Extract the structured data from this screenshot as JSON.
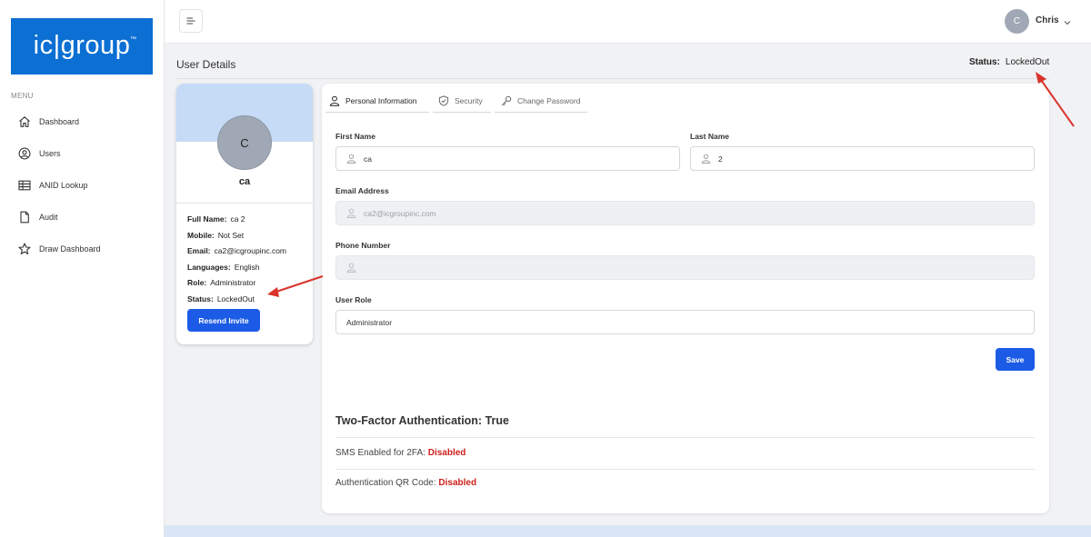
{
  "brand": {
    "logo_text": "ic|group",
    "logo_tm": "™"
  },
  "sidebar": {
    "menu_caption": "MENU",
    "items": [
      {
        "label": "Dashboard",
        "icon": "home-icon"
      },
      {
        "label": "Users",
        "icon": "user-circle-icon"
      },
      {
        "label": "ANID Lookup",
        "icon": "table-icon"
      },
      {
        "label": "Audit",
        "icon": "document-icon"
      },
      {
        "label": "Draw Dashboard",
        "icon": "star-icon"
      }
    ]
  },
  "topbar": {
    "user_initial": "C",
    "user_name": "Chris"
  },
  "page": {
    "title": "User Details",
    "status_label": "Status:",
    "status_value": "LockedOut"
  },
  "profile": {
    "initial": "C",
    "name": "ca",
    "details": [
      {
        "key": "Full Name:",
        "value": "ca 2"
      },
      {
        "key": "Mobile:",
        "value": "Not Set"
      },
      {
        "key": "Email:",
        "value": "ca2@icgroupinc.com"
      },
      {
        "key": "Languages:",
        "value": "English"
      },
      {
        "key": "Role:",
        "value": "Administrator"
      },
      {
        "key": "Status:",
        "value": "LockedOut"
      }
    ],
    "resend_label": "Resend Invite"
  },
  "tabs": [
    {
      "label": "Personal Information",
      "icon": "user-icon",
      "active": true
    },
    {
      "label": "Security",
      "icon": "shield-icon",
      "active": false
    },
    {
      "label": "Change Password",
      "icon": "key-icon",
      "active": false
    }
  ],
  "form": {
    "first_name": {
      "label": "First Name",
      "value": "ca"
    },
    "last_name": {
      "label": "Last Name",
      "value": "2"
    },
    "email": {
      "label": "Email Address",
      "value": "ca2@icgroupinc.com"
    },
    "phone": {
      "label": "Phone Number",
      "value": ""
    },
    "role": {
      "label": "User Role",
      "value": "Administrator"
    },
    "save_label": "Save"
  },
  "two_factor": {
    "title": "Two-Factor Authentication: True",
    "sms_label": "SMS Enabled for 2FA:",
    "sms_value": "Disabled",
    "qr_label": "Authentication QR Code:",
    "qr_value": "Disabled"
  },
  "colors": {
    "brand_blue": "#0b6fd3",
    "button_blue": "#1b5be6",
    "danger": "#cc1f1a",
    "annotation_arrow": "#d9342b"
  }
}
